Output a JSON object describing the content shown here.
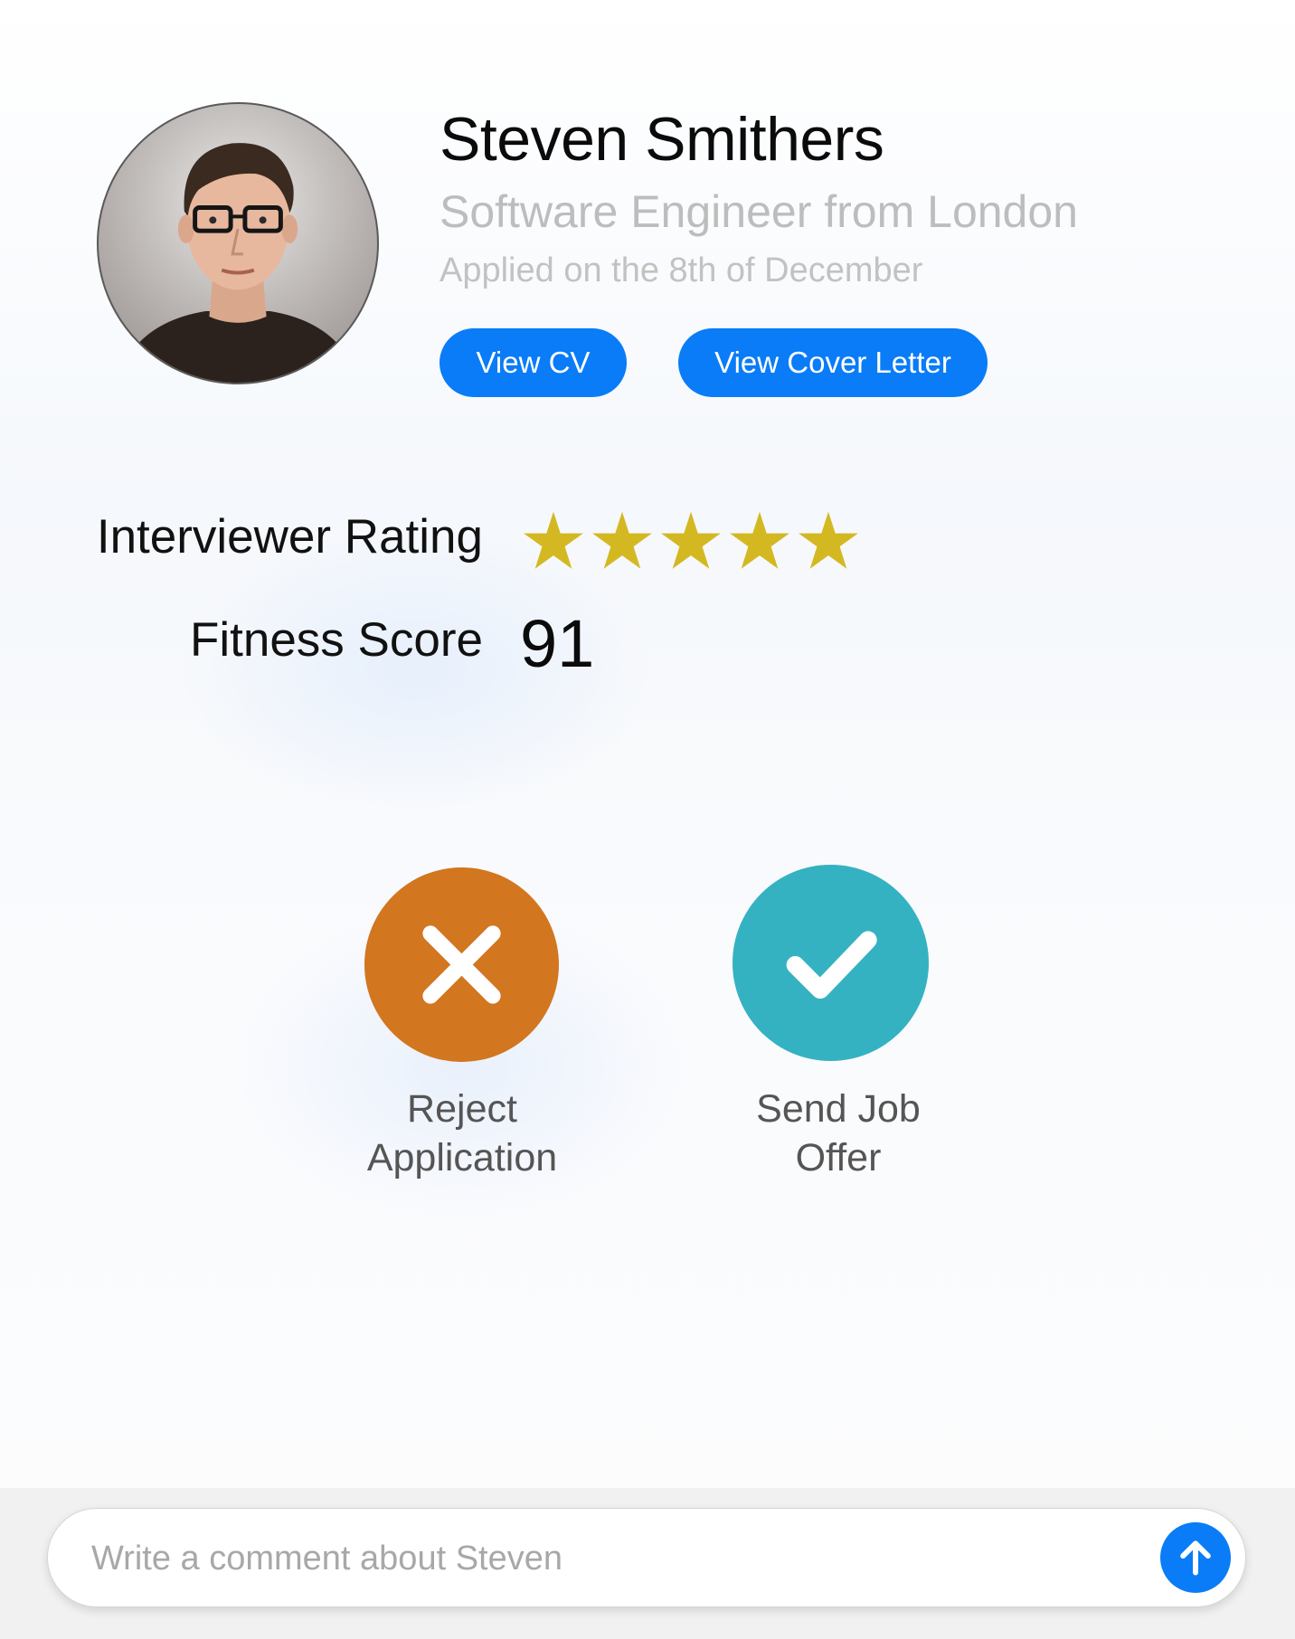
{
  "candidate": {
    "name": "Steven Smithers",
    "subtitle": "Software Engineer from London",
    "applied": "Applied on the 8th of December"
  },
  "buttons": {
    "view_cv": "View CV",
    "view_cover_letter": "View Cover Letter"
  },
  "rating": {
    "label": "Interviewer Rating",
    "stars": 5,
    "max_stars": 5,
    "star_color": "#d4b821"
  },
  "fitness": {
    "label": "Fitness Score",
    "value": "91"
  },
  "actions": {
    "reject": {
      "line1": "Reject",
      "line2": "Application",
      "color": "#d2761f",
      "icon": "close-icon"
    },
    "offer": {
      "line1": "Send Job",
      "line2": "Offer",
      "color": "#35b2c1",
      "icon": "checkmark-icon"
    }
  },
  "comment": {
    "placeholder": "Write a comment about Steven",
    "send_icon": "arrow-up-icon"
  },
  "colors": {
    "accent": "#0a7cf7"
  }
}
